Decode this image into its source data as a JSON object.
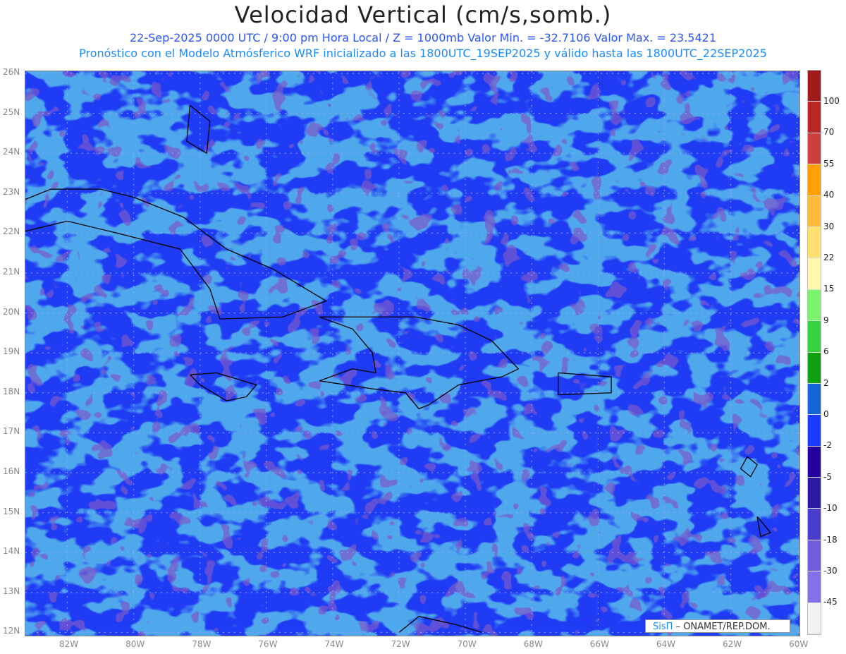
{
  "title": "Velocidad Vertical (cm/s,somb.)",
  "subtitle1": "22-Sep-2025  0000 UTC / 9:00 pm Hora Local / Z = 1000mb   Valor Min. = -32.7106  Valor Max. = 23.5421",
  "subtitle2": "Pronóstico con el Modelo Atmósferico WRF inicializado a las 1800UTC_19SEP2025 y válido hasta las  1800UTC_22SEP2025",
  "lat_labels": [
    "26N",
    "25N",
    "24N",
    "23N",
    "22N",
    "21N",
    "20N",
    "19N",
    "18N",
    "17N",
    "16N",
    "15N",
    "14N",
    "13N",
    "12N"
  ],
  "lon_labels": [
    "82W",
    "80W",
    "78W",
    "76W",
    "74W",
    "72W",
    "70W",
    "68W",
    "66W",
    "64W",
    "62W",
    "60W"
  ],
  "colorbar": {
    "labels": [
      "100",
      "70",
      "55",
      "40",
      "30",
      "22",
      "15",
      "9",
      "6",
      "2",
      "0",
      "-2",
      "-5",
      "-10",
      "-18",
      "-30",
      "-45"
    ],
    "colors": [
      "#a01c1c",
      "#b82626",
      "#cc3f3f",
      "#ffa000",
      "#ffbc3a",
      "#ffe070",
      "#fff7aa",
      "#7af46c",
      "#37d13f",
      "#0fa010",
      "#1565d6",
      "#1a3cff",
      "#24009e",
      "#2c1aa3",
      "#4a3ccc",
      "#715cdb",
      "#8470e8",
      "#f2f2f2"
    ]
  },
  "logo": {
    "brand": "SisΠ",
    "org": "– ONAMET/REP.DOM."
  }
}
